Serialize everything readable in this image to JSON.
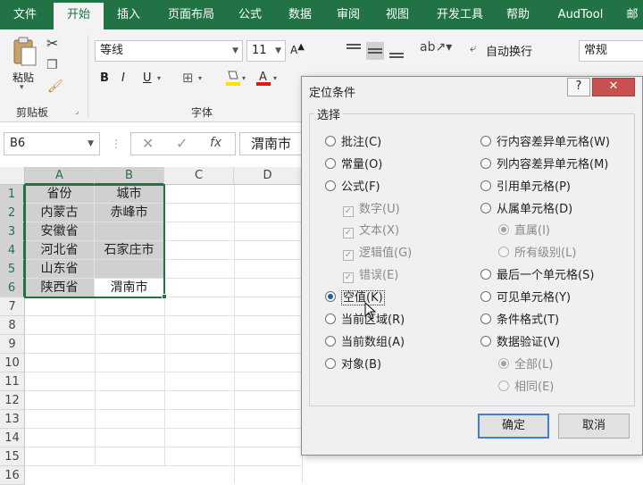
{
  "ribbon": {
    "tabs": [
      "文件",
      "开始",
      "插入",
      "页面布局",
      "公式",
      "数据",
      "审阅",
      "视图",
      "开发工具",
      "帮助",
      "AudTool",
      "邮"
    ],
    "active_tab": "开始",
    "clipboard": {
      "paste_label": "粘贴",
      "group_label": "剪贴板"
    },
    "font": {
      "name": "等线",
      "size": "11",
      "bold": "B",
      "italic": "I",
      "underline": "U",
      "group_label": "字体"
    },
    "alignment": {
      "wrap_text": "自动换行"
    },
    "number": {
      "format": "常规"
    }
  },
  "formula_bar": {
    "name_box": "B6",
    "fx": "fx",
    "content": "渭南市"
  },
  "sheet": {
    "columns": [
      "A",
      "B",
      "C",
      "D"
    ],
    "rows": [
      "1",
      "2",
      "3",
      "4",
      "5",
      "6",
      "7",
      "8",
      "9",
      "10",
      "11",
      "12",
      "13",
      "14",
      "15",
      "16"
    ],
    "cells": {
      "A1": "省份",
      "B1": "城市",
      "A2": "内蒙古",
      "B2": "赤峰市",
      "A3": "安徽省",
      "B3": "",
      "A4": "河北省",
      "B4": "石家庄市",
      "A5": "山东省",
      "B5": "",
      "A6": "陕西省",
      "B6": "渭南市"
    }
  },
  "dialog": {
    "title": "定位条件",
    "help": "?",
    "close": "✕",
    "group_label": "选择",
    "left_options": [
      "批注(C)",
      "常量(O)",
      "公式(F)",
      "数字(U)",
      "文本(X)",
      "逻辑值(G)",
      "错误(E)",
      "空值(K)",
      "当前区域(R)",
      "当前数组(A)",
      "对象(B)"
    ],
    "right_options": [
      "行内容差异单元格(W)",
      "列内容差异单元格(M)",
      "引用单元格(P)",
      "从属单元格(D)",
      "直属(I)",
      "所有级别(L)",
      "最后一个单元格(S)",
      "可见单元格(Y)",
      "条件格式(T)",
      "数据验证(V)",
      "全部(L)",
      "相同(E)"
    ],
    "selected": "空值(K)",
    "ok": "确定",
    "cancel": "取消"
  }
}
